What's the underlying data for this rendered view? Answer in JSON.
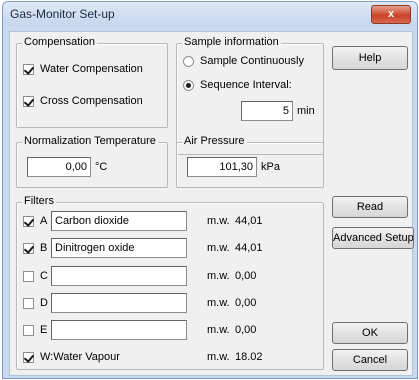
{
  "window": {
    "title": "Gas-Monitor Set-up",
    "close_glyph": "x"
  },
  "compensation": {
    "label": "Compensation",
    "water": {
      "label": "Water Compensation",
      "checked": true
    },
    "cross": {
      "label": "Cross Compensation",
      "checked": true
    }
  },
  "sample": {
    "label": "Sample information",
    "continuous": {
      "label": "Sample Continuously",
      "selected": false
    },
    "sequence": {
      "label": "Sequence Interval:",
      "selected": true
    },
    "interval_value": "5",
    "interval_unit": "min"
  },
  "normalization": {
    "label": "Normalization Temperature",
    "value": "0,00",
    "unit": "°C"
  },
  "pressure": {
    "label": "Air Pressure",
    "value": "101,30",
    "unit": "kPa"
  },
  "filters": {
    "label": "Filters",
    "rows": [
      {
        "letter": "A",
        "checked": true,
        "name": "Carbon dioxide",
        "mw_label": "m.w.",
        "mw": "44,01"
      },
      {
        "letter": "B",
        "checked": true,
        "name": "Dinitrogen oxide",
        "mw_label": "m.w.",
        "mw": "44,01"
      },
      {
        "letter": "C",
        "checked": false,
        "name": "",
        "mw_label": "m.w.",
        "mw": "0,00"
      },
      {
        "letter": "D",
        "checked": false,
        "name": "",
        "mw_label": "m.w.",
        "mw": "0,00"
      },
      {
        "letter": "E",
        "checked": false,
        "name": "",
        "mw_label": "m.w.",
        "mw": "0,00"
      }
    ],
    "water_vapour": {
      "label": "W:Water Vapour",
      "checked": true,
      "mw_label": "m.w.",
      "mw": "18.02"
    }
  },
  "buttons": {
    "help": "Help",
    "read": "Read",
    "advanced": "Advanced Setup",
    "ok": "OK",
    "cancel": "Cancel"
  }
}
